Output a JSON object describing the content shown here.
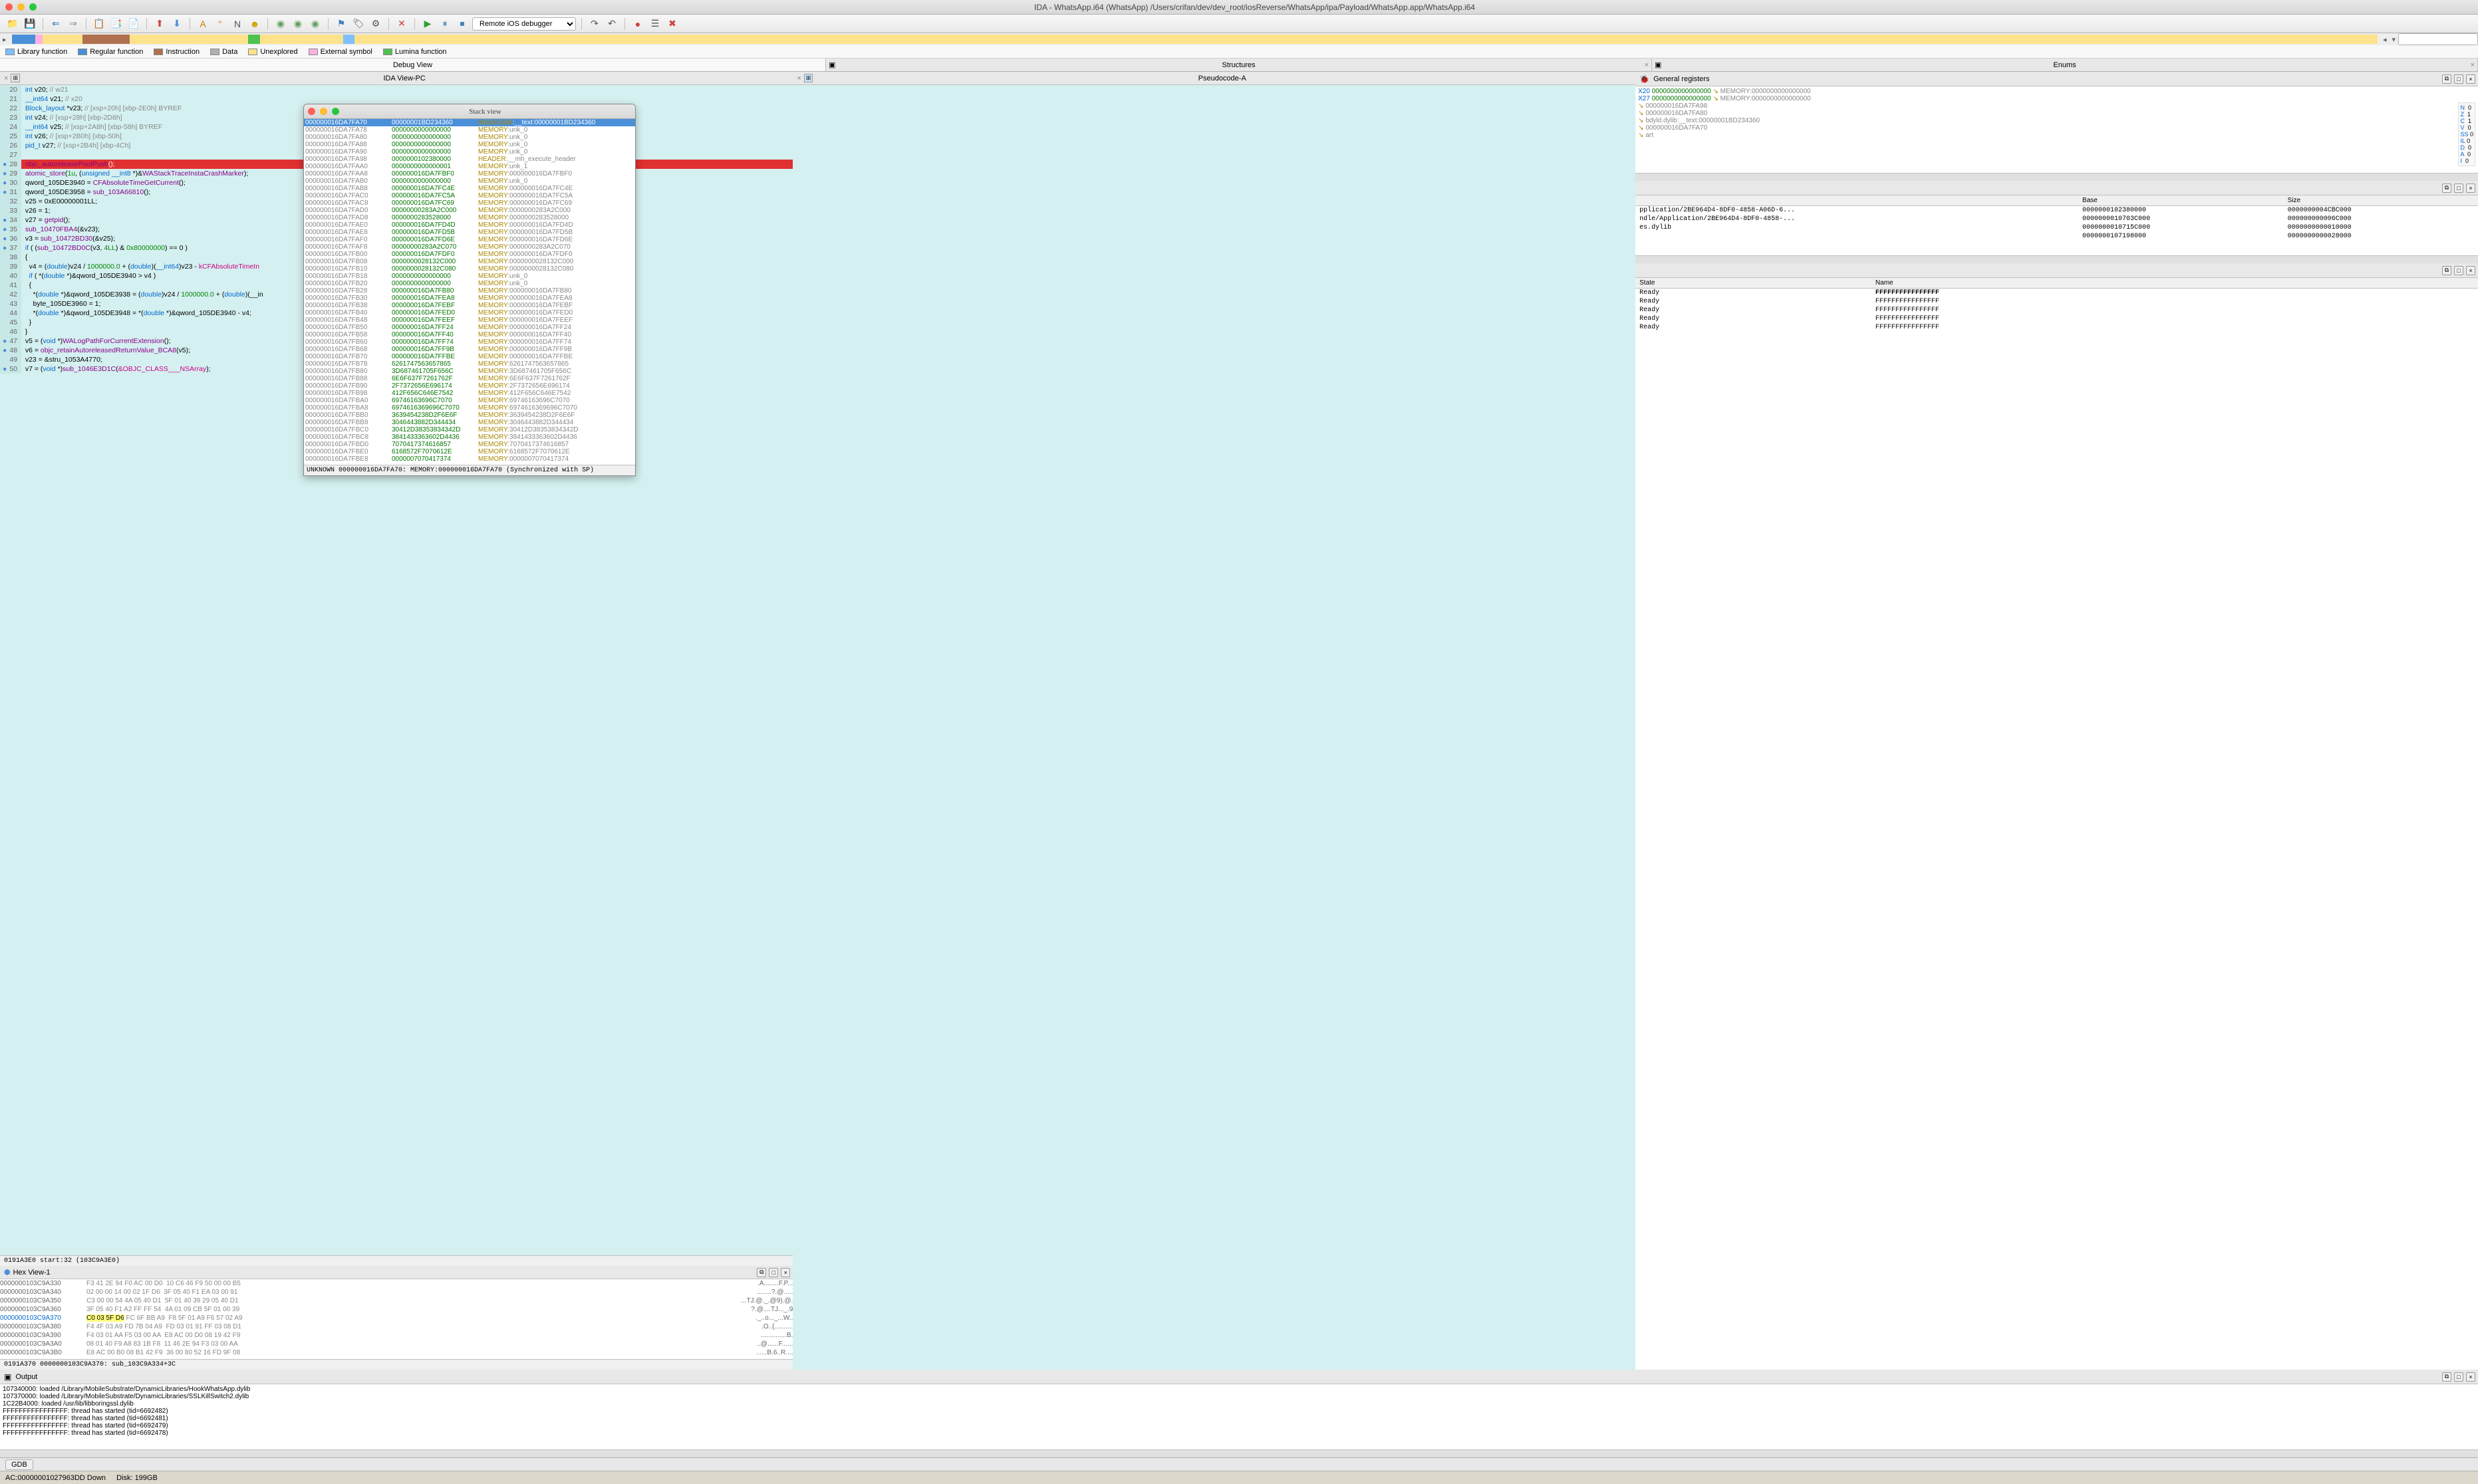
{
  "window": {
    "title": "IDA - WhatsApp.i64 (WhatsApp) /Users/crifan/dev/dev_root/iosReverse/WhatsApp/ipa/Payload/WhatsApp.app/WhatsApp.i64"
  },
  "toolbar": {
    "debugger": "Remote iOS debugger"
  },
  "legend": [
    {
      "color": "#7fbfff",
      "label": "Library function"
    },
    {
      "color": "#4a90d9",
      "label": "Regular function"
    },
    {
      "color": "#b07050",
      "label": "Instruction"
    },
    {
      "color": "#b0b0b0",
      "label": "Data"
    },
    {
      "color": "#fce28a",
      "label": "Unexplored"
    },
    {
      "color": "#ffb0e0",
      "label": "External symbol"
    },
    {
      "color": "#50c050",
      "label": "Lumina function"
    }
  ],
  "main_tabs": [
    {
      "label": "Debug View",
      "active": true
    },
    {
      "label": "Structures",
      "active": false
    },
    {
      "label": "Enums",
      "active": false
    }
  ],
  "view_tabs": {
    "left": "IDA View-PC",
    "mid": "Pseudocode-A",
    "right": "General registers"
  },
  "code": {
    "lines": [
      {
        "n": 20,
        "t": "  int v20; // w21"
      },
      {
        "n": 21,
        "t": "  __int64 v21; // x20"
      },
      {
        "n": 22,
        "t": "  Block_layout *v23; // [xsp+20h] [xbp-2E0h] BYREF"
      },
      {
        "n": 23,
        "t": "  int v24; // [xsp+28h] [xbp-2D8h]"
      },
      {
        "n": 24,
        "t": "  __int64 v25; // [xsp+2A8h] [xbp-58h] BYREF"
      },
      {
        "n": 25,
        "t": "  int v26; // [xsp+2B0h] [xbp-50h]"
      },
      {
        "n": 26,
        "t": "  pid_t v27; // [xsp+2B4h] [xbp-4Ch]"
      },
      {
        "n": 27,
        "t": ""
      },
      {
        "n": 28,
        "t": "  objc_autoreleasePoolPush();",
        "hl": "red",
        "dot": true
      },
      {
        "n": 29,
        "t": "  atomic_store(1u, (unsigned __int8 *)&WAStackTraceInstaCrashMarker);",
        "dot": true
      },
      {
        "n": 30,
        "t": "  qword_105DE3940 = CFAbsoluteTimeGetCurrent();",
        "dot": true
      },
      {
        "n": 31,
        "t": "  qword_105DE3958 = sub_103A66810();",
        "dot": true
      },
      {
        "n": 32,
        "t": "  v25 = 0xE00000001LL;"
      },
      {
        "n": 33,
        "t": "  v26 = 1;"
      },
      {
        "n": 34,
        "t": "  v27 = getpid();",
        "dot": true
      },
      {
        "n": 35,
        "t": "  sub_10470FBA4(&v23);",
        "dot": true
      },
      {
        "n": 36,
        "t": "  v3 = sub_10472BD30(&v25);",
        "dot": true
      },
      {
        "n": 37,
        "t": "  if ( (sub_10472BD0C(v3, 4LL) & 0x80000000) == 0 )",
        "dot": true
      },
      {
        "n": 38,
        "t": "  {"
      },
      {
        "n": 39,
        "t": "    v4 = (double)v24 / 1000000.0 + (double)(__int64)v23 - kCFAbsoluteTimeIn"
      },
      {
        "n": 40,
        "t": "    if ( *(double *)&qword_105DE3940 > v4 )"
      },
      {
        "n": 41,
        "t": "    {"
      },
      {
        "n": 42,
        "t": "      *(double *)&qword_105DE3938 = (double)v24 / 1000000.0 + (double)(__in"
      },
      {
        "n": 43,
        "t": "      byte_105DE3960 = 1;"
      },
      {
        "n": 44,
        "t": "      *(double *)&qword_105DE3948 = *(double *)&qword_105DE3940 - v4;"
      },
      {
        "n": 45,
        "t": "    }"
      },
      {
        "n": 46,
        "t": "  }"
      },
      {
        "n": 47,
        "t": "  v5 = (void *)WALogPathForCurrentExtension();",
        "dot": true
      },
      {
        "n": 48,
        "t": "  v6 = objc_retainAutoreleasedReturnValue_BCA8(v5);",
        "dot": true
      },
      {
        "n": 49,
        "t": "  v23 = &stru_1053A4770;"
      },
      {
        "n": 50,
        "t": "  v7 = (void *)sub_1046E3D1C(&OBJC_CLASS___NSArray);",
        "dot": true
      }
    ],
    "status": "0191A3E0 start:32 (103C9A3E0)"
  },
  "hexview": {
    "title": "Hex View-1",
    "lines": [
      {
        "a": "0000000103C9A330",
        "b": "F3 41 2E 94 F0 AC 00 D0  10 C6 46 F9 50 00 00 B5",
        "t": ".A........F.P..."
      },
      {
        "a": "0000000103C9A340",
        "b": "02 00 00 14 00 02 1F D6  3F 05 40 F1 EA 03 00 91",
        "t": "........?.@....."
      },
      {
        "a": "0000000103C9A350",
        "b": "C3 00 00 54 4A 05 40 D1  5F 01 40 39 29 05 40 D1",
        "t": "...TJ.@._.@9).@."
      },
      {
        "a": "0000000103C9A360",
        "b": "3F 05 40 F1 A2 FF FF 54  4A 01 09 CB 5F 01 00 39",
        "t": "?.@....TJ..._.9"
      },
      {
        "a": "0000000103C9A370",
        "b": "C0 03 5F D6 FC 6F BB A9  F8 5F 01 A9 F6 57 02 A9",
        "t": "._..o..._...W..",
        "hl": true,
        "blue": true
      },
      {
        "a": "0000000103C9A380",
        "b": "F4 4F 03 A9 FD 7B 04 A9  FD 03 01 91 FF 03 08 D1",
        "t": ".O..{.........."
      },
      {
        "a": "0000000103C9A390",
        "b": "F4 03 01 AA F5 03 00 AA  E8 AC 00 D0 08 19 42 F9",
        "t": "..............B."
      },
      {
        "a": "0000000103C9A3A0",
        "b": "08 01 40 F9 A8 83 1B F8  11 46 2E 94 F3 03 00 AA",
        "t": "..@......F......"
      },
      {
        "a": "0000000103C9A3B0",
        "b": "E8 AC 00 B0 08 B1 42 F9  36 00 80 52 16 FD 9F 08",
        "t": "......B.6..R...."
      }
    ],
    "status": "0191A370 0000000103C9A370: sub_103C9A334+3C"
  },
  "stack": {
    "title": "Stack view",
    "lines": [
      {
        "a": "000000016DA7FA70",
        "v": "00000001BD234360",
        "m": "libdyld.dylib:__text:00000001BD234360",
        "sel": true
      },
      {
        "a": "000000016DA7FA78",
        "v": "0000000000000000",
        "m": "MEMORY:unk_0"
      },
      {
        "a": "000000016DA7FA80",
        "v": "0000000000000000",
        "m": "MEMORY:unk_0"
      },
      {
        "a": "000000016DA7FA88",
        "v": "0000000000000000",
        "m": "MEMORY:unk_0"
      },
      {
        "a": "000000016DA7FA90",
        "v": "0000000000000000",
        "m": "MEMORY:unk_0"
      },
      {
        "a": "000000016DA7FA98",
        "v": "0000000102380000",
        "m": "HEADER:__mh_execute_header"
      },
      {
        "a": "000000016DA7FAA0",
        "v": "0000000000000001",
        "m": "MEMORY:unk_1"
      },
      {
        "a": "000000016DA7FAA8",
        "v": "000000016DA7FBF0",
        "m": "MEMORY:000000016DA7FBF0"
      },
      {
        "a": "000000016DA7FAB0",
        "v": "0000000000000000",
        "m": "MEMORY:unk_0"
      },
      {
        "a": "000000016DA7FAB8",
        "v": "000000016DA7FC4E",
        "m": "MEMORY:000000016DA7FC4E"
      },
      {
        "a": "000000016DA7FAC0",
        "v": "000000016DA7FC5A",
        "m": "MEMORY:000000016DA7FC5A"
      },
      {
        "a": "000000016DA7FAC8",
        "v": "000000016DA7FC69",
        "m": "MEMORY:000000016DA7FC69"
      },
      {
        "a": "000000016DA7FAD0",
        "v": "00000000283A2C000",
        "m": "MEMORY:0000000283A2C000"
      },
      {
        "a": "000000016DA7FAD8",
        "v": "0000000283528000",
        "m": "MEMORY:0000000283528000"
      },
      {
        "a": "000000016DA7FAE0",
        "v": "000000016DA7FD4D",
        "m": "MEMORY:000000016DA7FD4D"
      },
      {
        "a": "000000016DA7FAE8",
        "v": "000000016DA7FD5B",
        "m": "MEMORY:000000016DA7FD5B"
      },
      {
        "a": "000000016DA7FAF0",
        "v": "000000016DA7FD6E",
        "m": "MEMORY:000000016DA7FD6E"
      },
      {
        "a": "000000016DA7FAF8",
        "v": "00000000283A2C070",
        "m": "MEMORY:0000000283A2C070"
      },
      {
        "a": "000000016DA7FB00",
        "v": "000000016DA7FDF0",
        "m": "MEMORY:000000016DA7FDF0"
      },
      {
        "a": "000000016DA7FB08",
        "v": "0000000028132C000",
        "m": "MEMORY:0000000028132C000"
      },
      {
        "a": "000000016DA7FB10",
        "v": "0000000028132C080",
        "m": "MEMORY:0000000028132C080"
      },
      {
        "a": "000000016DA7FB18",
        "v": "0000000000000000",
        "m": "MEMORY:unk_0"
      },
      {
        "a": "000000016DA7FB20",
        "v": "0000000000000000",
        "m": "MEMORY:unk_0"
      },
      {
        "a": "000000016DA7FB28",
        "v": "000000016DA7FB80",
        "m": "MEMORY:000000016DA7FB80"
      },
      {
        "a": "000000016DA7FB30",
        "v": "000000016DA7FEA8",
        "m": "MEMORY:000000016DA7FEA8"
      },
      {
        "a": "000000016DA7FB38",
        "v": "000000016DA7FEBF",
        "m": "MEMORY:000000016DA7FEBF"
      },
      {
        "a": "000000016DA7FB40",
        "v": "000000016DA7FED0",
        "m": "MEMORY:000000016DA7FED0"
      },
      {
        "a": "000000016DA7FB48",
        "v": "000000016DA7FEEF",
        "m": "MEMORY:000000016DA7FEEF"
      },
      {
        "a": "000000016DA7FB50",
        "v": "000000016DA7FF24",
        "m": "MEMORY:000000016DA7FF24"
      },
      {
        "a": "000000016DA7FB58",
        "v": "000000016DA7FF40",
        "m": "MEMORY:000000016DA7FF40"
      },
      {
        "a": "000000016DA7FB60",
        "v": "000000016DA7FF74",
        "m": "MEMORY:000000016DA7FF74"
      },
      {
        "a": "000000016DA7FB68",
        "v": "000000016DA7FF9B",
        "m": "MEMORY:000000016DA7FF9B"
      },
      {
        "a": "000000016DA7FB70",
        "v": "000000016DA7FFBE",
        "m": "MEMORY:000000016DA7FFBE"
      },
      {
        "a": "000000016DA7FB78",
        "v": "6261747563657865",
        "m": "MEMORY:6261747563657865"
      },
      {
        "a": "000000016DA7FB80",
        "v": "3D687461705F656C",
        "m": "MEMORY:3D687461705F656C"
      },
      {
        "a": "000000016DA7FB88",
        "v": "6E6F637F7261762F",
        "m": "MEMORY:6E6F637F7261762F"
      },
      {
        "a": "000000016DA7FB90",
        "v": "2F7372656E696174",
        "m": "MEMORY:2F7372656E696174"
      },
      {
        "a": "000000016DA7FB98",
        "v": "412F656C646E7542",
        "m": "MEMORY:412F656C646E7542"
      },
      {
        "a": "000000016DA7FBA0",
        "v": "69746163696C7070",
        "m": "MEMORY:69746163696C7070"
      },
      {
        "a": "000000016DA7FBA8",
        "v": "6974616369696C7070",
        "m": "MEMORY:6974616369696C7070"
      },
      {
        "a": "000000016DA7FBB0",
        "v": "3639454238D2F6E6F",
        "m": "MEMORY:3639454238D2F6E6F"
      },
      {
        "a": "000000016DA7FBB8",
        "v": "3046443882D344434",
        "m": "MEMORY:3046443882D344434"
      },
      {
        "a": "000000016DA7FBC0",
        "v": "30412D38353834342D",
        "m": "MEMORY:30412D38353834342D"
      },
      {
        "a": "000000016DA7FBC8",
        "v": "3841433363602D4436",
        "m": "MEMORY:3841433363602D4436"
      },
      {
        "a": "000000016DA7FBD0",
        "v": "7070417374616857",
        "m": "MEMORY:7070417374616857"
      },
      {
        "a": "000000016DA7FBE0",
        "v": "6168572F7070612E",
        "m": "MEMORY:6168572F7070612E"
      },
      {
        "a": "000000016DA7FBE8",
        "v": "0000007070417374",
        "m": "MEMORY:0000007070417374"
      }
    ],
    "status": "UNKNOWN 000000016DA7FA70: MEMORY:000000016DA7FA70 (Synchronized with SP)"
  },
  "registers": {
    "lines": [
      {
        "n": "X20",
        "v": "0000000000000000",
        "m": "MEMORY:0000000000000000"
      },
      {
        "n": "X27",
        "v": "0000000000000000",
        "m": "MEMORY:0000000000000000"
      },
      {
        "n": "",
        "v": "",
        "m": "000000016DA7FA98"
      },
      {
        "n": "",
        "v": "",
        "m": "000000016DA7FA80"
      },
      {
        "n": "",
        "v": "",
        "m": "bdyld.dylib:__text:00000001BD234360"
      },
      {
        "n": "",
        "v": "",
        "m": "000000016DA7FA70"
      },
      {
        "n": "",
        "v": "",
        "m": "art"
      }
    ],
    "flags": [
      {
        "n": "N",
        "v": "0"
      },
      {
        "n": "Z",
        "v": "1"
      },
      {
        "n": "C",
        "v": "1"
      },
      {
        "n": "V",
        "v": "0"
      },
      {
        "n": "SS",
        "v": "0"
      },
      {
        "n": "IL",
        "v": "0"
      },
      {
        "n": "D",
        "v": "0"
      },
      {
        "n": "A",
        "v": "0"
      },
      {
        "n": "I",
        "v": "0"
      }
    ]
  },
  "modules": {
    "cols": [
      "",
      "Base",
      "Size"
    ],
    "rows": [
      {
        "p": "pplication/2BE964D4-8DF0-4858-A06D-6...",
        "b": "0000000102380000",
        "s": "0000000004CBC000"
      },
      {
        "p": "ndle/Application/2BE964D4-8DF0-4858-...",
        "b": "0000000010703C000",
        "s": "000000000006C000"
      },
      {
        "p": "es.dylib",
        "b": "0000000010715C000",
        "s": "0000000000010000"
      },
      {
        "p": "",
        "b": "0000000107198000",
        "s": "0000000000028000"
      }
    ]
  },
  "threads": {
    "cols": [
      "State",
      "Name"
    ],
    "rows": [
      {
        "s": "Ready",
        "n": "FFFFFFFFFFFFFFFF",
        "bold": true
      },
      {
        "s": "Ready",
        "n": "FFFFFFFFFFFFFFFF"
      },
      {
        "s": "Ready",
        "n": "FFFFFFFFFFFFFFFF"
      },
      {
        "s": "Ready",
        "n": "FFFFFFFFFFFFFFFF"
      },
      {
        "s": "Ready",
        "n": "FFFFFFFFFFFFFFFF"
      }
    ]
  },
  "output": {
    "title": "Output",
    "lines": [
      "107340000: loaded /Library/MobileSubstrate/DynamicLibraries/HookWhatsApp.dylib",
      "107370000: loaded /Library/MobileSubstrate/DynamicLibraries/SSLKillSwitch2.dylib",
      "1C22B4000: loaded /usr/lib/libboringssl.dylib",
      "FFFFFFFFFFFFFFFF: thread has started (tid=6692482)",
      "FFFFFFFFFFFFFFFF: thread has started (tid=6692481)",
      "FFFFFFFFFFFFFFFF: thread has started (tid=6692479)",
      "FFFFFFFFFFFFFFFF: thread has started (tid=6692478)"
    ]
  },
  "bottom": {
    "gdb": "GDB"
  },
  "statusbar": {
    "au": "AC:00000001027963DD Down",
    "disk": "Disk: 199GB"
  }
}
